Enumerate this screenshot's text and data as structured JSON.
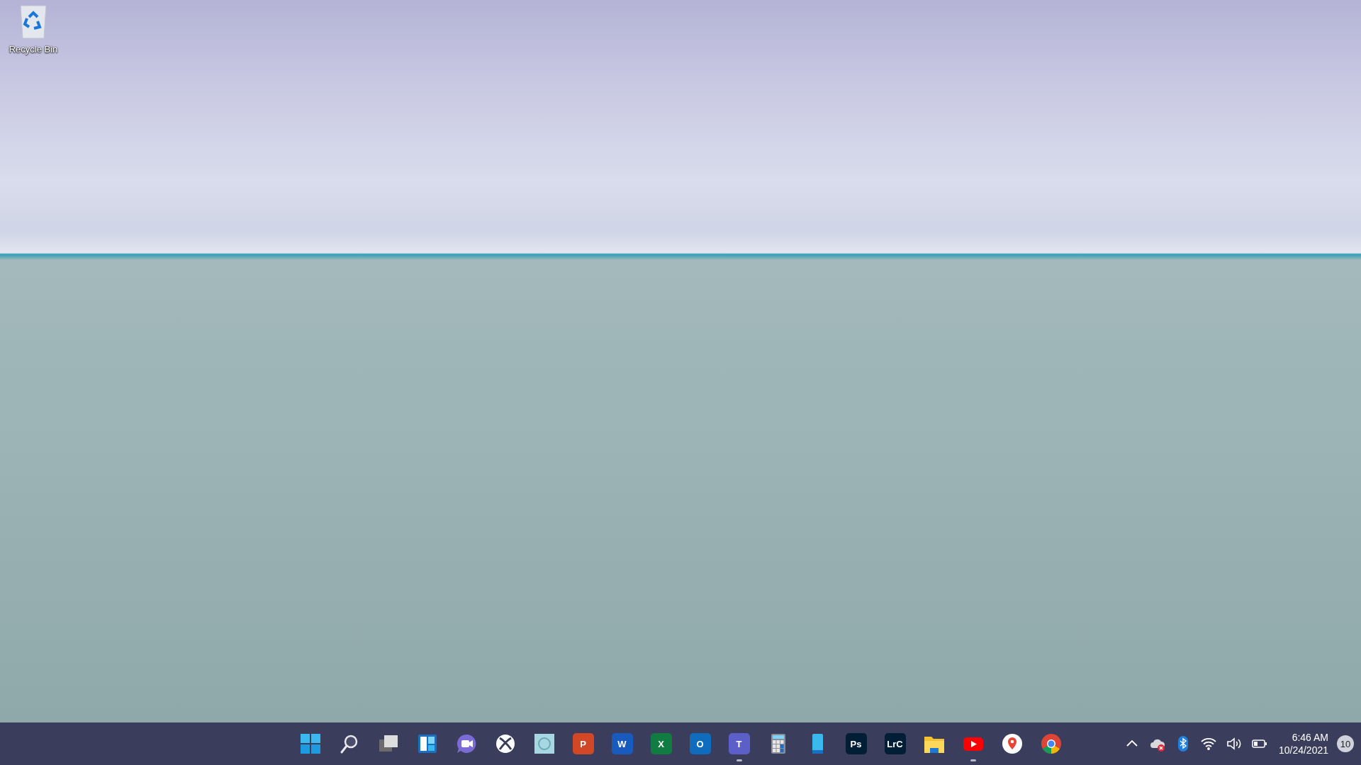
{
  "desktop": {
    "icons": [
      {
        "label": "Recycle Bin",
        "kind": "recycle-bin"
      }
    ]
  },
  "taskbar": {
    "apps": [
      {
        "kind": "start",
        "running": false
      },
      {
        "kind": "search",
        "running": false
      },
      {
        "kind": "task-view",
        "running": false
      },
      {
        "kind": "widgets",
        "running": false
      },
      {
        "kind": "chat",
        "running": false
      },
      {
        "kind": "xbox",
        "running": false
      },
      {
        "kind": "tile",
        "running": false
      },
      {
        "kind": "letter-tile",
        "label": "P",
        "color": "#d24726",
        "running": false
      },
      {
        "kind": "letter-tile",
        "label": "W",
        "color": "#185abd",
        "running": false
      },
      {
        "kind": "letter-tile",
        "label": "X",
        "color": "#107c41",
        "running": false
      },
      {
        "kind": "letter-tile",
        "label": "O",
        "color": "#0f6cbd",
        "running": false
      },
      {
        "kind": "letter-tile",
        "label": "T",
        "color": "#5b5fc7",
        "running": true
      },
      {
        "kind": "calculator",
        "running": false
      },
      {
        "kind": "phone",
        "running": false
      },
      {
        "kind": "letter-tile",
        "label": "Ps",
        "color": "#001e36",
        "running": false
      },
      {
        "kind": "letter-tile",
        "label": "LrC",
        "color": "#001e36",
        "running": false
      },
      {
        "kind": "folder",
        "running": false
      },
      {
        "kind": "play",
        "running": true
      },
      {
        "kind": "map-pin",
        "running": false
      },
      {
        "kind": "browser",
        "running": false
      }
    ],
    "tray": {
      "icons": [
        {
          "kind": "chevron"
        },
        {
          "kind": "cloud-error"
        },
        {
          "kind": "bluetooth"
        },
        {
          "kind": "wifi"
        },
        {
          "kind": "volume"
        },
        {
          "kind": "battery"
        }
      ],
      "time": "6:46 AM",
      "date": "10/24/2021",
      "notifications": "10"
    }
  }
}
